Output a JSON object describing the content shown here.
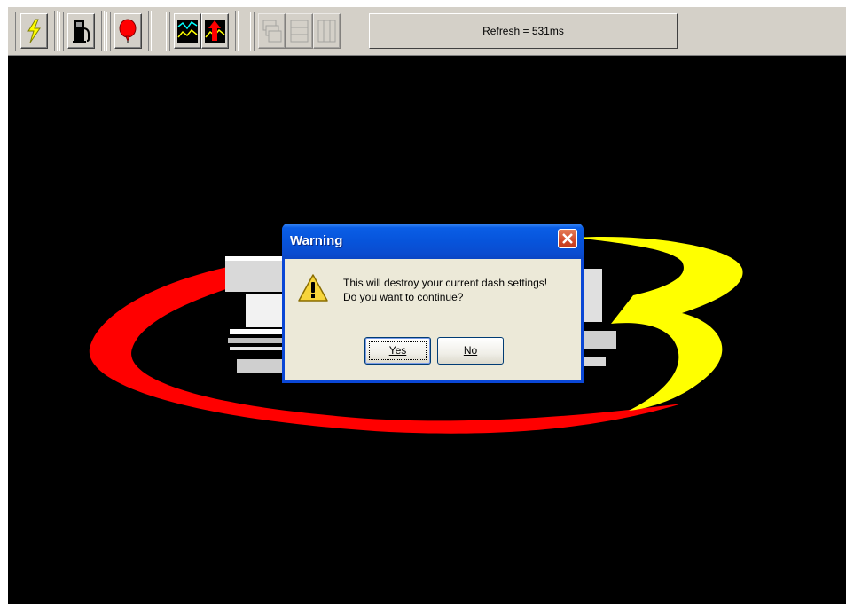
{
  "toolbar": {
    "buttons": [
      {
        "icon": "lightning-icon"
      },
      {
        "icon": "fuel-pump-icon"
      },
      {
        "icon": "balloon-icon"
      },
      {
        "icon": "graph-icon"
      },
      {
        "icon": "graph-upload-icon"
      },
      {
        "icon": "layout-cascade-icon",
        "disabled": true
      },
      {
        "icon": "layout-horizontal-icon",
        "disabled": true
      },
      {
        "icon": "layout-vertical-icon",
        "disabled": true
      }
    ],
    "refresh_text": "Refresh = 531ms"
  },
  "dialog": {
    "title": "Warning",
    "message_line1": "This will destroy your current dash settings!",
    "message_line2": "Do you want to continue?",
    "yes_label": "Yes",
    "no_label": "No",
    "icon": "warning-icon"
  },
  "colors": {
    "canvas": "#000000",
    "logo_red": "#ff0000",
    "logo_yellow": "#ffff00",
    "title_blue": "#0754db"
  }
}
